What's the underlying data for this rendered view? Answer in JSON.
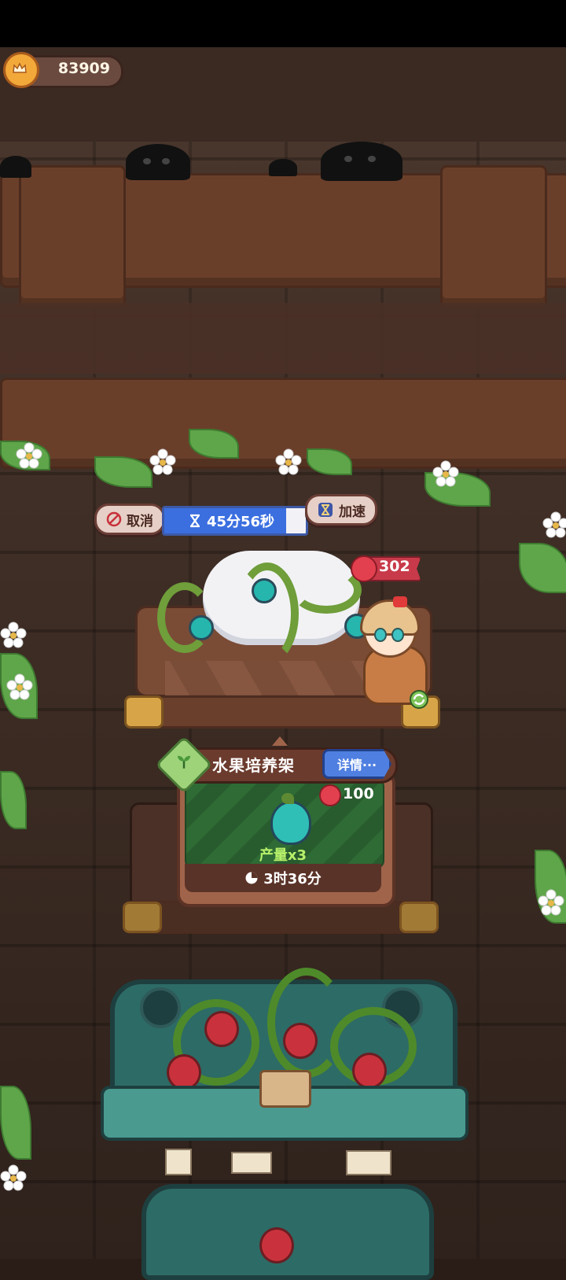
{
  "currency": {
    "amount": "83909",
    "icon": "crown-coin-icon"
  },
  "production": {
    "cancel_label": "取消",
    "timer_remaining": "45分56秒",
    "timer_progress": 0.86,
    "speedup_label": "加速",
    "stock_count": "302"
  },
  "info_card": {
    "title": "水果培养架",
    "detail_label": "详情···",
    "apple_cost": "100",
    "yield_label": "产量x3",
    "duration": "3时36分"
  },
  "colors": {
    "timer_fill": "#3b6fe0",
    "apple_badge": "#c83a4a",
    "card_bg": "#a0644a",
    "detail_button": "#4f7fe0",
    "yield_text": "#b7f06a"
  }
}
